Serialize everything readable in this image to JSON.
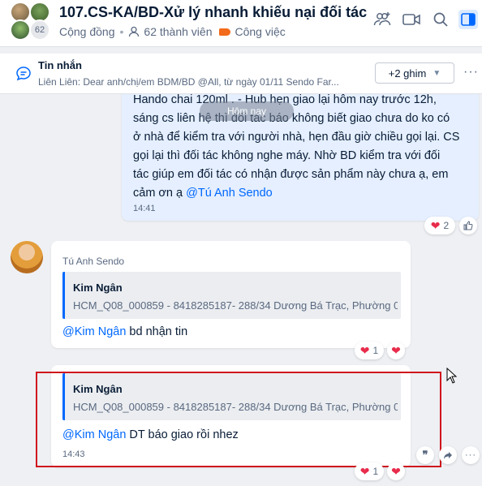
{
  "header": {
    "member_avatar_count": "62",
    "title": "107.CS-KA/BD-Xử lý nhanh khiếu nại đối tác",
    "category": "Cộng đồng",
    "members": "62 thành viên",
    "tag": "Công việc",
    "icons": [
      "add-member-icon",
      "video-call-icon",
      "search-icon",
      "sidebar-toggle-icon"
    ]
  },
  "pinned": {
    "title": "Tin nhắn",
    "text": "Liên Liên: Dear anh/chị/em BDM/BD @All, từ ngày 01/11 Sendo Far...",
    "pins_label": "+2 ghim",
    "more": "···"
  },
  "date_divider": "Hôm nay",
  "own_message": {
    "line1": "Hando chai 120ml . - Hub hẹn giao lại hôm nay trước 12h,",
    "line2": "sáng cs liên hệ thì đối tác báo không biết giao chưa do ko có",
    "line3": "ở nhà để kiểm tra với người nhà, hẹn đầu giờ chiều gọi lại. CS",
    "line4": "gọi lại thì đối tác không nghe máy. Nhờ BD kiểm tra với đối",
    "line5": "tác giúp em đối tác có nhận được sản phẩm này chưa ạ, em",
    "line6_prefix": "cảm ơn ạ ",
    "mention": "@Tú Anh Sendo",
    "time": "14:41",
    "reaction_count": "2"
  },
  "reply1": {
    "sender": "Tú Anh Sendo",
    "quote_name": "Kim Ngân",
    "quote_text": "HCM_Q08_000859 - 8418285187- 288/34 Dương Bá Trạc, Phường 0...",
    "mention": "@Kim Ngân",
    "text": " bd nhận tin",
    "reaction_count": "1"
  },
  "reply2": {
    "quote_name": "Kim Ngân",
    "quote_text": "HCM_Q08_000859 - 8418285187- 288/34 Dương Bá Trạc, Phường 0...",
    "mention": "@Kim Ngân",
    "text": " DT báo giao rồi nhez",
    "time": "14:43",
    "reaction_count": "1"
  },
  "colors": {
    "accent": "#0068ff",
    "highlight": "#d0161c",
    "heart": "#e82c4c",
    "tag": "#f26a1b"
  }
}
